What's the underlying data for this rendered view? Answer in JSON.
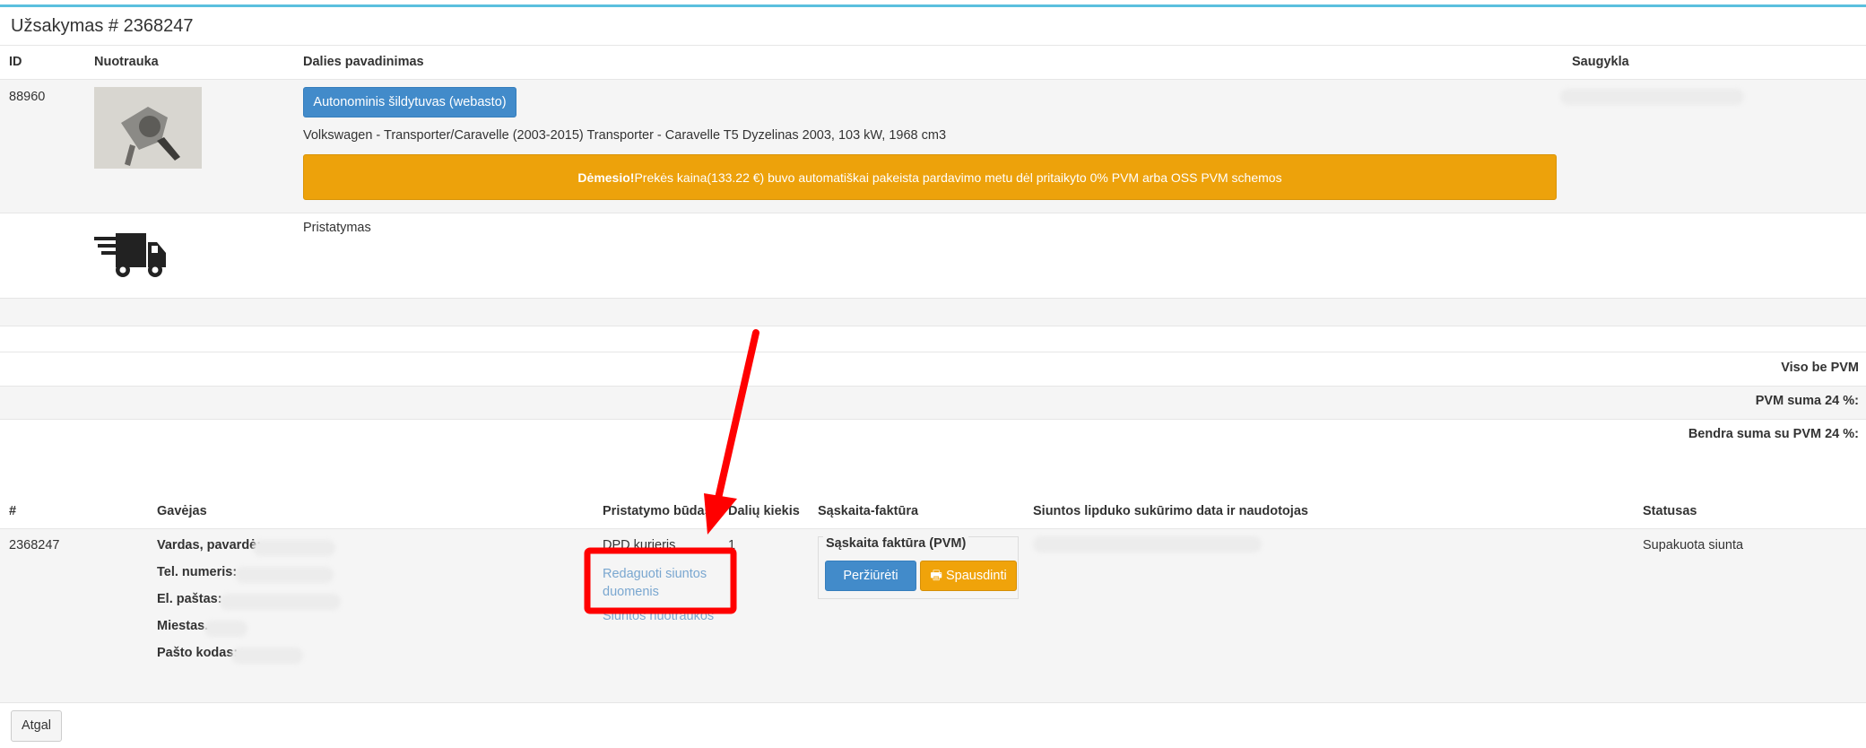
{
  "title": "Užsakymas # 2368247",
  "items_table": {
    "headers": [
      "ID",
      "Nuotrauka",
      "Dalies pavadinimas",
      "Saugykla"
    ],
    "row": {
      "id": "88960",
      "part_button": "Autonominis šildytuvas (webasto)",
      "vehicle": "Volkswagen - Transporter/Caravelle (2003-2015) Transporter - Caravelle T5 Dyzelinas 2003, 103 kW, 1968 cm3",
      "alert_strong": "Dėmesio!",
      "alert_text": " Prekės kaina(133.22 €) buvo automatiškai pakeista pardavimo metu dėl pritaikyto 0% PVM arba OSS PVM schemos"
    },
    "delivery_row": {
      "label": "Pristatymas",
      "icon": "delivery-truck-icon"
    }
  },
  "totals": {
    "without_vat": "Viso be PVM",
    "vat_sum": "PVM suma 24 %:",
    "total_with_vat": "Bendra suma su PVM 24 %:"
  },
  "orders_table": {
    "headers": [
      "#",
      "Gavėjas",
      "Pristatymo būdas",
      "Dalių kiekis",
      "Sąskaita-faktūra",
      "Siuntos lipduko sukūrimo data ir naudotojas",
      "Statusas"
    ],
    "row": {
      "number": "2368247",
      "recipient_labels": [
        "Vardas, pavardė:",
        "Tel. numeris:",
        "El. paštas:",
        "Miestas.",
        "Pašto kodas:"
      ],
      "delivery_method": "DPD kurjeris",
      "edit_link": "Redaguoti siuntos duomenis",
      "photos_link": "Siuntos nuotraukos",
      "quantity": "1",
      "invoice_legend": "Sąskaita faktūra (PVM)",
      "view_button": "Peržiūrėti",
      "print_button": "Spausdinti",
      "status": "Supakuota siunta"
    }
  },
  "back_button": "Atgal",
  "colors": {
    "accent_blue": "#428bca",
    "warning_orange": "#eda20b",
    "annotation_red": "#ff0000",
    "top_bar": "#5bc0de"
  }
}
